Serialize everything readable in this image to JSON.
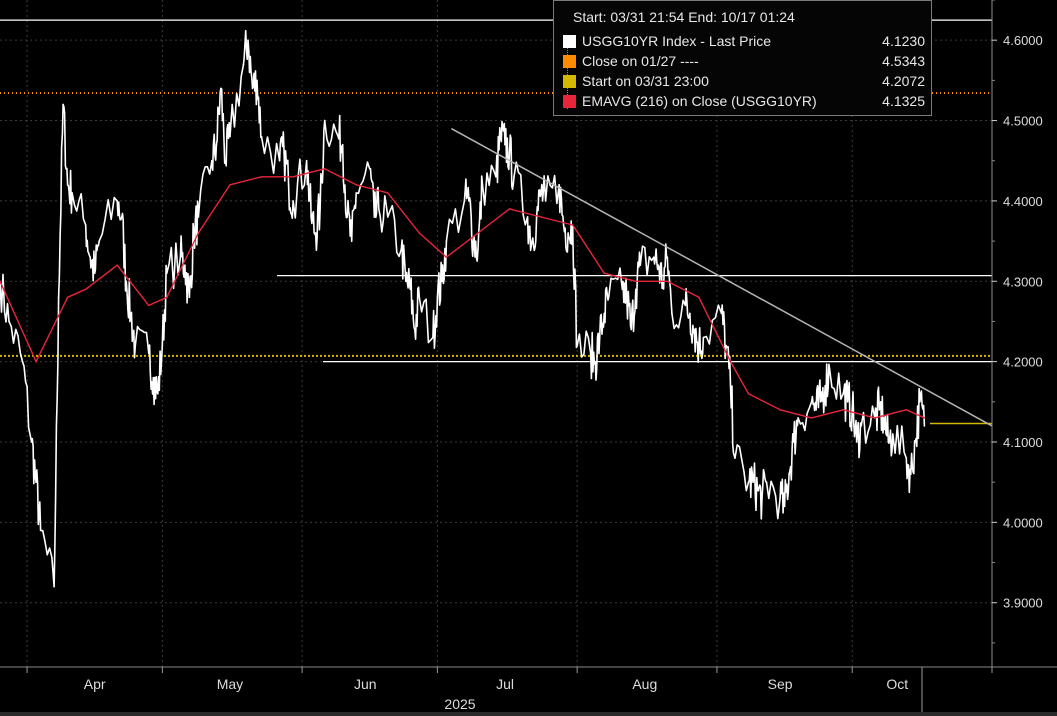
{
  "chart_data": {
    "type": "line",
    "ylim": [
      3.82,
      4.65
    ],
    "y_ticks": [
      "4.6000",
      "4.5000",
      "4.4000",
      "4.3000",
      "4.2000",
      "4.1000",
      "4.0000",
      "3.9000"
    ],
    "y_tick_values": [
      4.6,
      4.5,
      4.4,
      4.3,
      4.2,
      4.1,
      4.0,
      3.9
    ],
    "x_month_labels": [
      "Apr",
      "May",
      "Jun",
      "Jul",
      "Aug",
      "Sep",
      "Oct"
    ],
    "x_year_label": "2025",
    "grid": true,
    "legend_position": "top-right",
    "legend": {
      "range_text": "Start: 03/31 21:54 End: 10/17 01:24",
      "entries": [
        {
          "label": "USGG10YR Index - Last Price",
          "value": "4.1230",
          "color": "#ffffff"
        },
        {
          "label": "Close on 01/27 ----",
          "value": "4.5343",
          "color": "#ff8c00"
        },
        {
          "label": "Start on 03/31 23:00",
          "value": "4.2072",
          "color": "#d4b800"
        },
        {
          "label": "EMAVG (216)  on Close (USGG10YR)",
          "value": "4.1325",
          "color": "#e8253a"
        }
      ]
    },
    "reference_lines": [
      {
        "name": "Close on 01/27",
        "value": 4.5343,
        "color": "#ff8c00",
        "style": "dotted"
      },
      {
        "name": "Start on 03/31 23:00",
        "value": 4.2072,
        "color": "#d4b800",
        "style": "dotted"
      },
      {
        "value": 4.625,
        "color": "#ffffff",
        "style": "solid"
      },
      {
        "value": 4.307,
        "color": "#ffffff",
        "style": "solid"
      },
      {
        "value": 4.2,
        "color": "#ffffff",
        "style": "solid"
      }
    ],
    "trendline": {
      "from_date": "Jul 01",
      "from_value": 4.49,
      "to_date": "Oct 31",
      "to_value": 4.12,
      "color": "#b4b4b4"
    },
    "last_price_marker": {
      "value": 4.123,
      "color": "#d4b800"
    },
    "series": [
      {
        "name": "USGG10YR Index - Last Price",
        "color": "#ffffff",
        "x": [
          "Mar 26",
          "Mar 28",
          "Mar 31",
          "Apr 02",
          "Apr 03",
          "Apr 04",
          "Apr 07",
          "Apr 08",
          "Apr 09",
          "Apr 10",
          "Apr 11",
          "Apr 14",
          "Apr 15",
          "Apr 16",
          "Apr 17",
          "Apr 21",
          "Apr 22",
          "Apr 23",
          "Apr 24",
          "Apr 25",
          "Apr 28",
          "Apr 29",
          "Apr 30",
          "May 01",
          "May 02",
          "May 05",
          "May 06",
          "May 07",
          "May 08",
          "May 09",
          "May 12",
          "May 13",
          "May 14",
          "May 15",
          "May 16",
          "May 19",
          "May 20",
          "May 21",
          "May 22",
          "May 23",
          "May 27",
          "May 28",
          "May 29",
          "May 30",
          "Jun 02",
          "Jun 03",
          "Jun 04",
          "Jun 05",
          "Jun 06",
          "Jun 09",
          "Jun 10",
          "Jun 11",
          "Jun 12",
          "Jun 13",
          "Jun 16",
          "Jun 17",
          "Jun 18",
          "Jun 20",
          "Jun 23",
          "Jun 24",
          "Jun 25",
          "Jun 26",
          "Jun 27",
          "Jun 30",
          "Jul 01",
          "Jul 02",
          "Jul 03",
          "Jul 07",
          "Jul 08",
          "Jul 09",
          "Jul 10",
          "Jul 11",
          "Jul 14",
          "Jul 15",
          "Jul 16",
          "Jul 17",
          "Jul 18",
          "Jul 21",
          "Jul 22",
          "Jul 23",
          "Jul 24",
          "Jul 25",
          "Jul 28",
          "Jul 29",
          "Jul 30",
          "Jul 31",
          "Aug 01",
          "Aug 04",
          "Aug 05",
          "Aug 06",
          "Aug 07",
          "Aug 08",
          "Aug 11",
          "Aug 12",
          "Aug 13",
          "Aug 14",
          "Aug 15",
          "Aug 18",
          "Aug 19",
          "Aug 20",
          "Aug 21",
          "Aug 22",
          "Aug 25",
          "Aug 26",
          "Aug 27",
          "Aug 28",
          "Aug 29",
          "Sep 02",
          "Sep 03",
          "Sep 04",
          "Sep 05",
          "Sep 08",
          "Sep 09",
          "Sep 10",
          "Sep 11",
          "Sep 12",
          "Sep 15",
          "Sep 16",
          "Sep 17",
          "Sep 18",
          "Sep 19",
          "Sep 22",
          "Sep 23",
          "Sep 24",
          "Sep 25",
          "Sep 26",
          "Sep 29",
          "Sep 30",
          "Oct 01",
          "Oct 02",
          "Oct 03",
          "Oct 06",
          "Oct 07",
          "Oct 08",
          "Oct 09",
          "Oct 10",
          "Oct 13",
          "Oct 14",
          "Oct 15",
          "Oct 16",
          "Oct 17"
        ],
        "values": [
          4.3,
          4.25,
          4.2,
          4.1,
          4.05,
          3.99,
          3.92,
          4.28,
          4.52,
          4.42,
          4.41,
          4.37,
          4.33,
          4.31,
          4.35,
          4.4,
          4.38,
          4.3,
          4.26,
          4.22,
          4.21,
          4.18,
          4.16,
          4.22,
          4.31,
          4.33,
          4.32,
          4.28,
          4.36,
          4.38,
          4.45,
          4.47,
          4.54,
          4.45,
          4.48,
          4.57,
          4.6,
          4.54,
          4.55,
          4.48,
          4.45,
          4.46,
          4.42,
          4.4,
          4.45,
          4.38,
          4.36,
          4.39,
          4.5,
          4.48,
          4.47,
          4.38,
          4.35,
          4.41,
          4.44,
          4.38,
          4.39,
          4.38,
          4.34,
          4.3,
          4.29,
          4.24,
          4.28,
          4.23,
          4.28,
          4.3,
          4.35,
          4.4,
          4.4,
          4.35,
          4.34,
          4.42,
          4.43,
          4.48,
          4.47,
          4.46,
          4.43,
          4.38,
          4.35,
          4.38,
          4.41,
          4.4,
          4.42,
          4.37,
          4.36,
          4.37,
          4.22,
          4.21,
          4.2,
          4.23,
          4.26,
          4.28,
          4.29,
          4.28,
          4.24,
          4.29,
          4.32,
          4.33,
          4.32,
          4.3,
          4.33,
          4.26,
          4.27,
          4.26,
          4.24,
          4.22,
          4.23,
          4.26,
          4.22,
          4.17,
          4.08,
          4.05,
          4.05,
          4.04,
          4.03,
          4.05,
          4.03,
          4.02,
          4.06,
          4.1,
          4.13,
          4.15,
          4.14,
          4.15,
          4.17,
          4.19,
          4.16,
          4.15,
          4.14,
          4.1,
          4.12,
          4.13,
          4.14,
          4.13,
          4.1,
          4.11,
          4.08,
          4.06,
          4.1,
          4.15,
          4.12
        ]
      },
      {
        "name": "EMAVG (216)  on Close (USGG10YR)",
        "color": "#e8253a",
        "x": [
          "Mar 26",
          "Apr 03",
          "Apr 10",
          "Apr 14",
          "Apr 21",
          "Apr 28",
          "May 02",
          "May 09",
          "May 16",
          "May 23",
          "May 30",
          "Jun 06",
          "Jun 13",
          "Jun 20",
          "Jun 27",
          "Jul 03",
          "Jul 10",
          "Jul 17",
          "Jul 24",
          "Jul 31",
          "Aug 07",
          "Aug 14",
          "Aug 21",
          "Aug 28",
          "Sep 04",
          "Sep 08",
          "Sep 15",
          "Sep 22",
          "Sep 29",
          "Oct 06",
          "Oct 13",
          "Oct 17"
        ],
        "values": [
          4.3,
          4.2,
          4.28,
          4.29,
          4.32,
          4.27,
          4.28,
          4.36,
          4.42,
          4.43,
          4.43,
          4.44,
          4.42,
          4.41,
          4.36,
          4.33,
          4.36,
          4.39,
          4.38,
          4.37,
          4.31,
          4.3,
          4.3,
          4.28,
          4.2,
          4.16,
          4.14,
          4.13,
          4.14,
          4.13,
          4.14,
          4.13
        ]
      }
    ]
  }
}
